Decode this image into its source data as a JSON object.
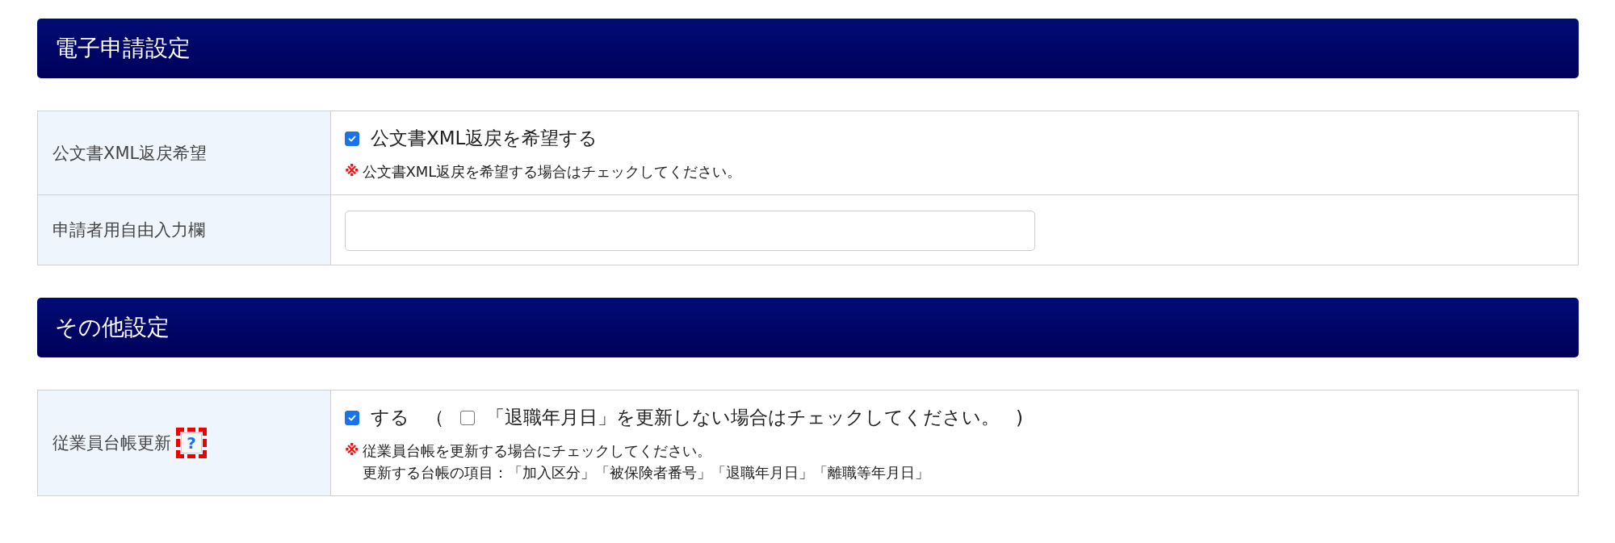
{
  "sections": [
    {
      "title": "電子申請設定",
      "rows": [
        {
          "label": "公文書XML返戻希望",
          "content": [
            {
              "kind": "checkboxes",
              "items": [
                {
                  "kind": "checkbox",
                  "label": "公文書XML返戻を希望する",
                  "checked": true
                }
              ]
            },
            {
              "kind": "note",
              "mark": "※",
              "lines": [
                "公文書XML返戻を希望する場合はチェックしてください。"
              ]
            }
          ]
        },
        {
          "label": "申請者用自由入力欄",
          "content": [
            {
              "kind": "input"
            }
          ]
        }
      ]
    },
    {
      "title": "その他設定",
      "rows": [
        {
          "label": "従業員台帳更新",
          "help": {
            "text": "?",
            "highlighted": true
          },
          "content": [
            {
              "kind": "checkboxes",
              "items": [
                {
                  "kind": "checkbox",
                  "label": "する",
                  "checked": true
                },
                {
                  "kind": "text",
                  "text": "（"
                },
                {
                  "kind": "checkbox",
                  "label": "「退職年月日」を更新しない場合はチェックしてください。",
                  "checked": false
                },
                {
                  "kind": "text",
                  "text": ")"
                }
              ]
            },
            {
              "kind": "note",
              "mark": "※",
              "lines": [
                "従業員台帳を更新する場合にチェックしてください。",
                "更新する台帳の項目：「加入区分」「被保険者番号」「退職年月日」「離職等年月日」"
              ]
            }
          ]
        }
      ]
    }
  ]
}
